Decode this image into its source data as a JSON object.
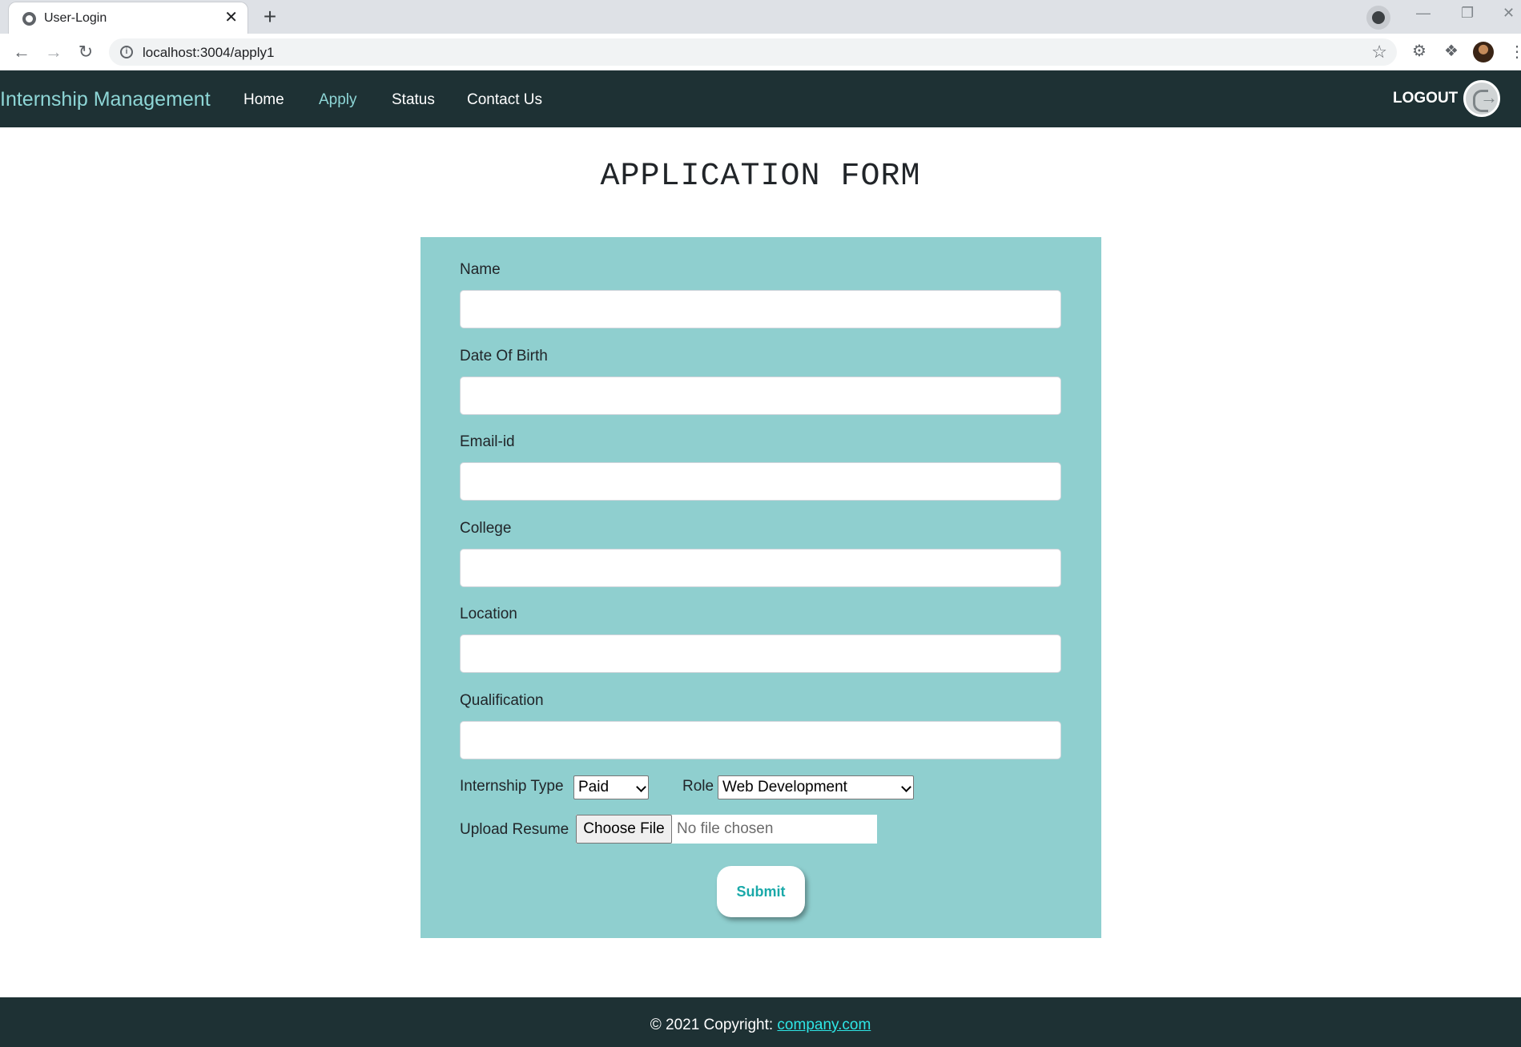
{
  "browser": {
    "tab_title": "User-Login",
    "tab_close": "✕",
    "new_tab": "+",
    "url": "localhost:3004/apply1",
    "window_controls": {
      "minimize": "—",
      "restore": "❐",
      "close": "✕"
    }
  },
  "navbar": {
    "brand": "Internship Management",
    "links": [
      {
        "label": "Home",
        "active": false
      },
      {
        "label": "Apply",
        "active": true
      },
      {
        "label": "Status",
        "active": false
      },
      {
        "label": "Contact Us",
        "active": false
      }
    ],
    "logout_label": "LOGOUT"
  },
  "page": {
    "title": "APPLICATION FORM"
  },
  "form": {
    "fields": [
      {
        "label": "Name",
        "value": ""
      },
      {
        "label": "Date Of Birth",
        "value": ""
      },
      {
        "label": "Email-id",
        "value": ""
      },
      {
        "label": "College",
        "value": ""
      },
      {
        "label": "Location",
        "value": ""
      },
      {
        "label": "Qualification",
        "value": ""
      }
    ],
    "internship_type_label": "Internship Type",
    "internship_type_value": "Paid",
    "role_label": "Role",
    "role_value": "Web Development",
    "upload_label": "Upload Resume",
    "choose_file": "Choose File",
    "file_status": "No file chosen",
    "submit_label": "Submit"
  },
  "footer": {
    "text": "© 2021 Copyright: ",
    "link": "company.com"
  },
  "colors": {
    "navbar_bg": "#1e3134",
    "brand": "#8ed6d6",
    "form_bg": "#8fcfcf",
    "submit_text": "#1aa9a9",
    "footer_link": "#2ee6e6"
  }
}
